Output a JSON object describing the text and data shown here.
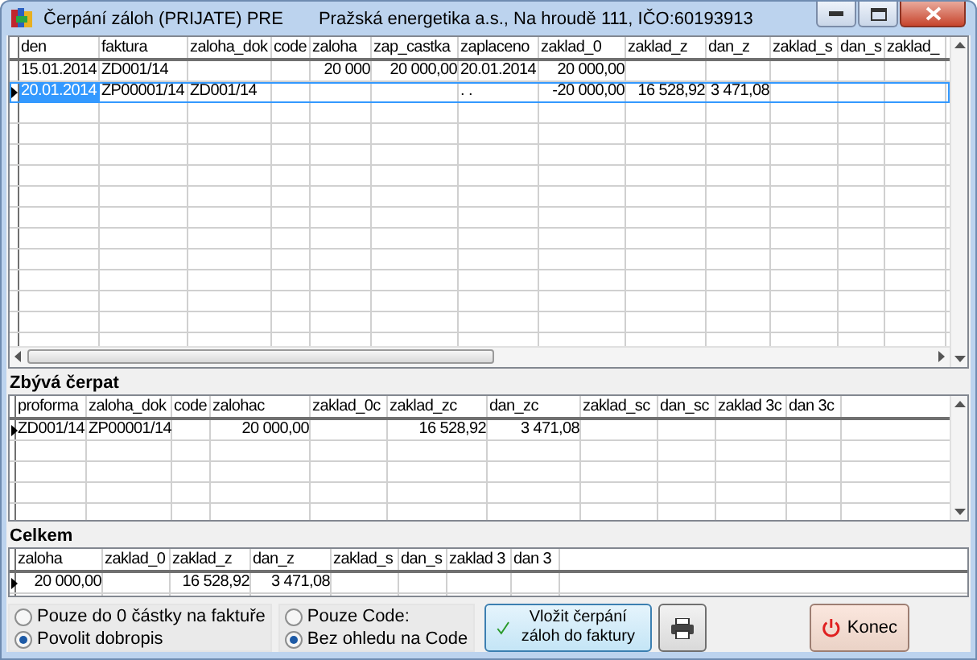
{
  "window": {
    "title": "Čerpání záloh (PRIJATE) PRE",
    "subtitle": "Pražská energetika a.s., Na hroudě 111, IČO:60193913"
  },
  "main_grid": {
    "focused": true,
    "columns": [
      "den",
      "faktura",
      "zaloha_dok",
      "code",
      "zaloha",
      "zap_castka",
      "zaplaceno",
      "zaklad_0",
      "zaklad_z",
      "dan_z",
      "zaklad_s",
      "dan_s",
      "zaklad_"
    ],
    "rows": [
      {
        "selected": false,
        "cells": [
          "15.01.2014",
          "ZD001/14",
          null,
          null,
          "20 000",
          "20 000,00",
          "20.01.2014",
          "20 000,00",
          null,
          null,
          null,
          null,
          null
        ]
      },
      {
        "selected": true,
        "cells": [
          "20.01.2014",
          "ZP00001/14",
          "ZD001/14",
          null,
          null,
          null,
          ". .",
          "-20 000,00",
          "16 528,92",
          "3 471,08",
          null,
          null,
          null
        ]
      }
    ]
  },
  "remaining": {
    "title": "Zbývá čerpat",
    "focused": false,
    "columns": [
      "proforma",
      "zaloha_dok",
      "code",
      "zalohac",
      "zaklad_0c",
      "zaklad_zc",
      "dan_zc",
      "zaklad_sc",
      "dan_sc",
      "zaklad 3c",
      "dan 3c"
    ],
    "rows": [
      {
        "selected": true,
        "cells": [
          "ZD001/14",
          "ZP00001/14",
          null,
          "20 000,00",
          null,
          "16 528,92",
          "3 471,08",
          null,
          null,
          null,
          null
        ]
      }
    ]
  },
  "total": {
    "title": "Celkem",
    "focused": false,
    "columns": [
      "zaloha",
      "zaklad_0",
      "zaklad_z",
      "dan_z",
      "zaklad_s",
      "dan_s",
      "zaklad 3",
      "dan 3"
    ],
    "rows": [
      {
        "selected": true,
        "cells": [
          "20 000,00",
          null,
          "16 528,92",
          "3 471,08",
          null,
          null,
          null,
          null
        ]
      }
    ]
  },
  "limit_options": [
    {
      "label": "Pouze do 0 částky na faktuře",
      "selected": false
    },
    {
      "label": "Povolit dobropis",
      "selected": true
    }
  ],
  "code_options": [
    {
      "label": "Pouze Code:",
      "selected": false
    },
    {
      "label": "Bez ohledu na Code",
      "selected": true
    }
  ],
  "buttons": {
    "insert": "Vložit čerpání záloh do faktury",
    "exit": "Konec"
  }
}
